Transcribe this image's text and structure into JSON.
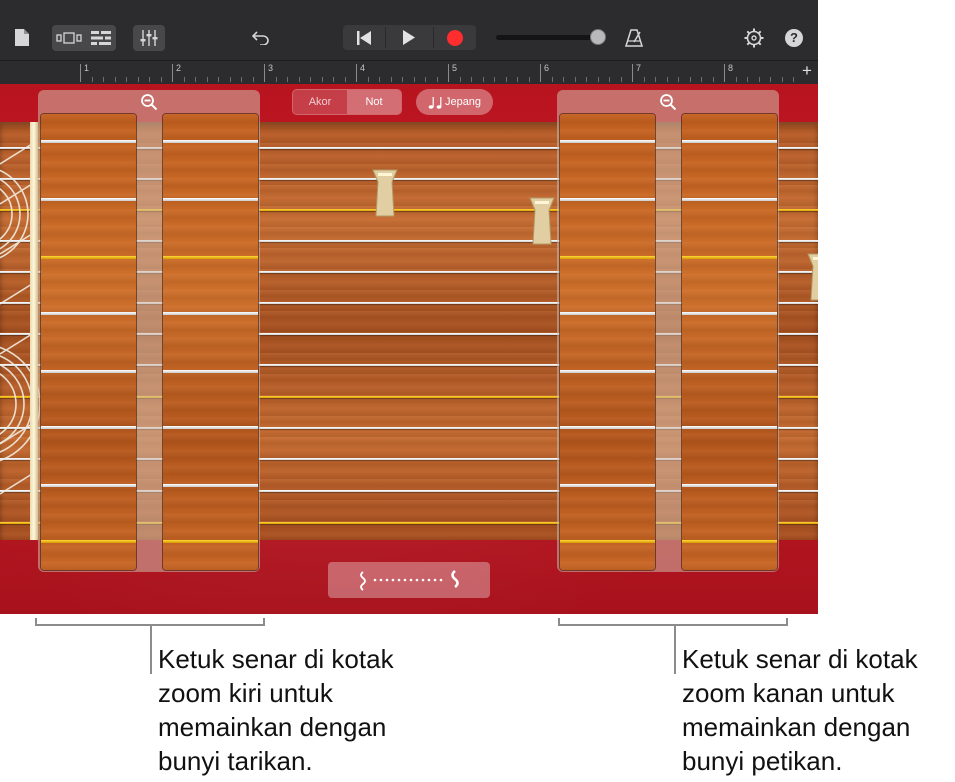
{
  "toolbar": {
    "icons": [
      "document-icon",
      "track-view-icon",
      "tracks-list-icon",
      "mixer-icon",
      "undo-icon",
      "go-to-start-icon",
      "play-icon",
      "record-icon",
      "metronome-icon",
      "settings-icon",
      "help-icon"
    ],
    "record_color": "#ff2d2d",
    "help_label": "?"
  },
  "ruler": {
    "bars": [
      "1",
      "2",
      "3",
      "4",
      "5",
      "6",
      "7",
      "8"
    ],
    "add_label": "+"
  },
  "instrument": {
    "mode_toggle": {
      "options": [
        "Akor",
        "Not"
      ],
      "selected": "Not"
    },
    "scale_button": {
      "icon": "music-notes-icon",
      "label": "Jepang"
    },
    "strum_bar": {
      "label": "⦚ ············ ⦚"
    },
    "colors": {
      "felt": "#b4151f",
      "wood": "#c06428",
      "gold_string": "#f5c01a"
    }
  },
  "annotations": {
    "left": "Ketuk senar di kotak zoom kiri untuk memainkan dengan bunyi tarikan.",
    "right": "Ketuk senar di kotak zoom kanan untuk memainkan dengan bunyi petikan."
  }
}
